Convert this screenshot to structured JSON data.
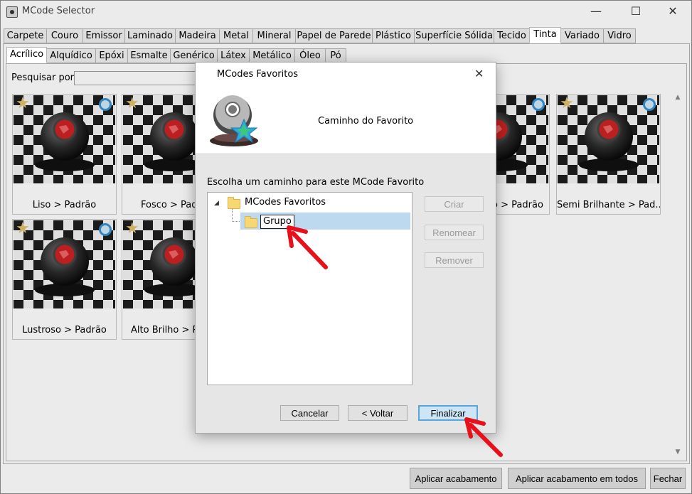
{
  "window": {
    "title": "MCode Selector",
    "controls": {
      "minimize": "—",
      "maximize": "☐",
      "close": "✕"
    }
  },
  "categories": [
    {
      "label": "Carpete",
      "active": false
    },
    {
      "label": "Couro",
      "active": false
    },
    {
      "label": "Emissor",
      "active": false
    },
    {
      "label": "Laminado",
      "active": false
    },
    {
      "label": "Madeira",
      "active": false
    },
    {
      "label": "Metal",
      "active": false
    },
    {
      "label": "Mineral",
      "active": false
    },
    {
      "label": "Papel de Parede",
      "active": false
    },
    {
      "label": "Plástico",
      "active": false
    },
    {
      "label": "Superfície Sólida",
      "active": false
    },
    {
      "label": "Tecido",
      "active": false
    },
    {
      "label": "Tinta",
      "active": true
    },
    {
      "label": "Variado",
      "active": false
    },
    {
      "label": "Vidro",
      "active": false
    }
  ],
  "subcategories": [
    {
      "label": "Acrílico",
      "active": true
    },
    {
      "label": "Alquídico",
      "active": false
    },
    {
      "label": "Epóxi",
      "active": false
    },
    {
      "label": "Esmalte",
      "active": false
    },
    {
      "label": "Genérico",
      "active": false
    },
    {
      "label": "Látex",
      "active": false
    },
    {
      "label": "Metálico",
      "active": false
    },
    {
      "label": "Óleo",
      "active": false
    },
    {
      "label": "Pó",
      "active": false
    }
  ],
  "search": {
    "label": "Pesquisar por:",
    "value": ""
  },
  "materials": [
    {
      "label": "Liso > Padrão"
    },
    {
      "label": "Fosco > Padrão"
    },
    {
      "label": "Acetinado > Padrão"
    },
    {
      "label": "Semi Brilhante > Pad..."
    },
    {
      "label": "Lustroso > Padrão"
    },
    {
      "label": "Alto Brilho > Padrão"
    }
  ],
  "bottom_buttons": {
    "apply": "Aplicar acabamento",
    "apply_all": "Aplicar acabamento em todos",
    "close": "Fechar"
  },
  "dialog": {
    "title": "MCodes Favoritos",
    "subtitle": "Caminho do Favorito",
    "prompt": "Escolha um caminho para este MCode Favorito",
    "tree": {
      "root": "MCodes Favoritos",
      "child": "Grupo",
      "toggle": "◢"
    },
    "side_buttons": {
      "create": "Criar",
      "rename": "Renomear",
      "remove": "Remover"
    },
    "footer_buttons": {
      "cancel": "Cancelar",
      "back": "< Voltar",
      "finish": "Finalizar"
    },
    "close": "✕"
  },
  "colors": {
    "accent": "#5aa6dc",
    "selection": "#bcd9f0",
    "annotation_arrow": "#e8101a",
    "star": "#e0c070"
  }
}
